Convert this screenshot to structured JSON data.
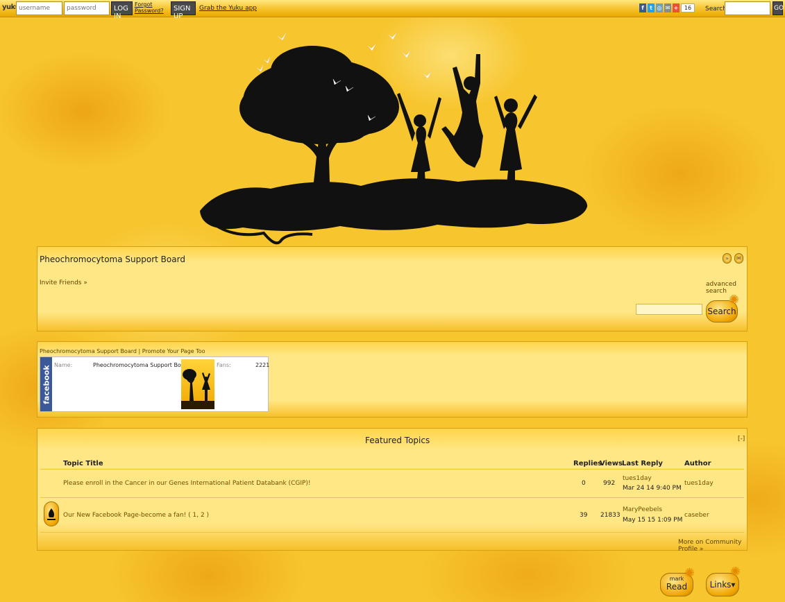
{
  "topbar": {
    "logo": "yuku",
    "username_placeholder": "username",
    "password_placeholder": "password",
    "login_label": "LOG IN",
    "forgot_line1": "Forgot",
    "forgot_line2": "Password?",
    "signup_label": "SIGN UP",
    "app_link": "Grab the Yuku app",
    "share_icons": [
      "facebook-icon",
      "twitter-icon",
      "rss-icon",
      "email-icon",
      "googleplus-icon"
    ],
    "share_count": "16",
    "search_label": "Search:",
    "go_label": "GO"
  },
  "board": {
    "title": "Pheochromocytoma Support Board",
    "invite_link": "Invite Friends »",
    "advanced_search": "advanced search",
    "search_button": "Search"
  },
  "facebook": {
    "header_link": "Pheochromocytoma Support Board | Promote Your Page Too",
    "strip_text": "facebook",
    "name_label": "Name:",
    "name_value": "Pheochromocytoma Support Board",
    "fans_label": "Fans:",
    "fans_value": "2221"
  },
  "featured": {
    "title": "Featured Topics",
    "collapse": "[-]",
    "columns": {
      "topic": "Topic Title",
      "replies": "Replies",
      "views": "Views",
      "last_reply": "Last Reply",
      "author": "Author"
    },
    "rows": [
      {
        "title": "Please enroll in the Cancer in our Genes International Patient Databank (CGIP)!",
        "replies": "0",
        "views": "992",
        "last_user": "tues1day",
        "last_date": "Mar 24 14 9:40 PM",
        "author": "tues1day"
      },
      {
        "title": "Our New Facebook Page-become a fan! ( 1, 2 )",
        "replies": "39",
        "views": "21833",
        "last_user": "MaryPeebels",
        "last_date": "May 15 15 1:09 PM",
        "author": "caseber"
      }
    ],
    "more_link": "More on Community Profile »"
  },
  "footer": {
    "mark_small": "mark",
    "mark_big": "Read",
    "links_label": "Links▾"
  },
  "colors": {
    "page_bg": "#f7c52e",
    "panel_bg": "#ffe785",
    "facebook_blue": "#3b5998"
  }
}
